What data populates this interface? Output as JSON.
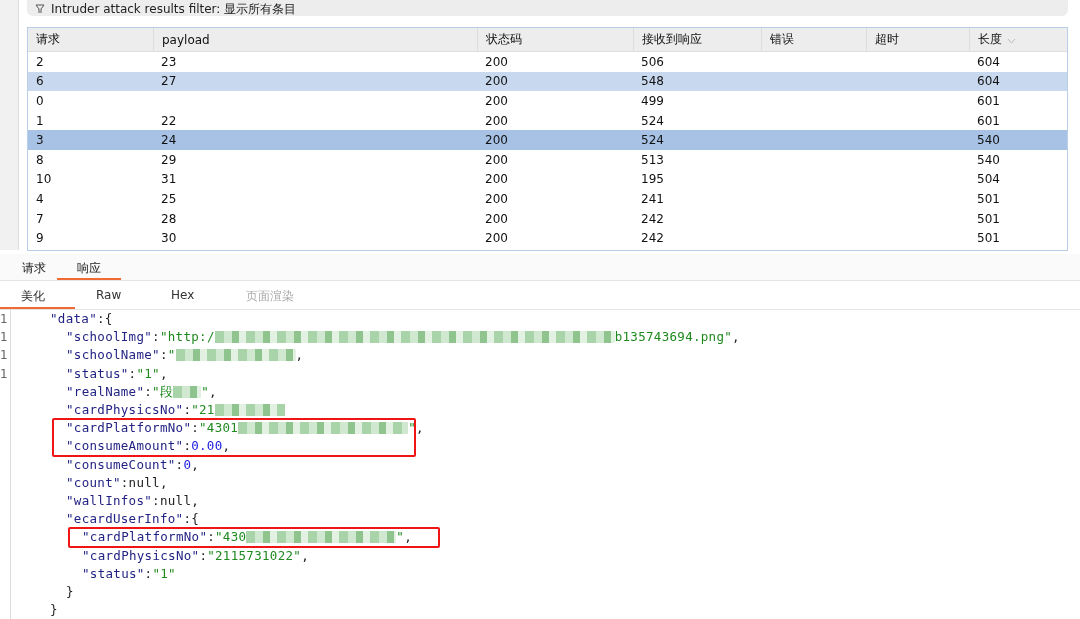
{
  "filter_bar": {
    "label": "Intruder attack results filter: 显示所有条目"
  },
  "table": {
    "columns": [
      {
        "label": "请求",
        "sorted": false
      },
      {
        "label": "payload",
        "sorted": false
      },
      {
        "label": "状态码",
        "sorted": false
      },
      {
        "label": "接收到响应",
        "sorted": false
      },
      {
        "label": "错误",
        "sorted": false
      },
      {
        "label": "超时",
        "sorted": false
      },
      {
        "label": "长度",
        "sorted": true
      }
    ],
    "rows": [
      {
        "cells": [
          "2",
          "23",
          "200",
          "506",
          "",
          "",
          "604"
        ],
        "selected": false,
        "focused": false
      },
      {
        "cells": [
          "6",
          "27",
          "200",
          "548",
          "",
          "",
          "604"
        ],
        "selected": true,
        "focused": false
      },
      {
        "cells": [
          "0",
          "",
          "200",
          "499",
          "",
          "",
          "601"
        ],
        "selected": false,
        "focused": false
      },
      {
        "cells": [
          "1",
          "22",
          "200",
          "524",
          "",
          "",
          "601"
        ],
        "selected": false,
        "focused": false
      },
      {
        "cells": [
          "3",
          "24",
          "200",
          "524",
          "",
          "",
          "540"
        ],
        "selected": true,
        "focused": true
      },
      {
        "cells": [
          "8",
          "29",
          "200",
          "513",
          "",
          "",
          "540"
        ],
        "selected": false,
        "focused": false
      },
      {
        "cells": [
          "10",
          "31",
          "200",
          "195",
          "",
          "",
          "504"
        ],
        "selected": false,
        "focused": false
      },
      {
        "cells": [
          "4",
          "25",
          "200",
          "241",
          "",
          "",
          "501"
        ],
        "selected": false,
        "focused": false
      },
      {
        "cells": [
          "7",
          "28",
          "200",
          "242",
          "",
          "",
          "501"
        ],
        "selected": false,
        "focused": false
      },
      {
        "cells": [
          "9",
          "30",
          "200",
          "242",
          "",
          "",
          "501"
        ],
        "selected": false,
        "focused": false
      }
    ]
  },
  "tabs": [
    {
      "label": "请求",
      "selected": false
    },
    {
      "label": "响应",
      "selected": true
    }
  ],
  "view_tabs": [
    {
      "label": "美化",
      "selected": true,
      "disabled": false
    },
    {
      "label": "Raw",
      "selected": false,
      "disabled": false
    },
    {
      "label": "Hex",
      "selected": false,
      "disabled": false
    },
    {
      "label": "页面渲染",
      "selected": false,
      "disabled": true
    }
  ],
  "gutter": [
    "1",
    "1",
    "1",
    "1"
  ],
  "code": [
    {
      "highlighted": false,
      "tokens": [
        {
          "kind": "key",
          "text": "\"data\""
        },
        {
          "kind": "punct",
          "text": ":{"
        }
      ],
      "children": [
        {
          "highlighted": false,
          "tokens": [
            {
              "kind": "key",
              "text": "\"schoolImg\""
            },
            {
              "kind": "punct",
              "text": ":"
            },
            {
              "kind": "str",
              "text": "\"http:/"
            },
            {
              "kind": "blur"
            },
            {
              "kind": "str",
              "text": "b135743694.png\""
            },
            {
              "kind": "punct",
              "text": ","
            }
          ]
        },
        {
          "highlighted": false,
          "tokens": [
            {
              "kind": "key",
              "text": "\"schoolName\""
            },
            {
              "kind": "punct",
              "text": ":"
            },
            {
              "kind": "str",
              "text": "\""
            },
            {
              "kind": "blur"
            },
            {
              "kind": "punct",
              "text": ","
            }
          ]
        },
        {
          "highlighted": false,
          "tokens": [
            {
              "kind": "key",
              "text": "\"status\""
            },
            {
              "kind": "punct",
              "text": ":"
            },
            {
              "kind": "str",
              "text": "\"1\""
            },
            {
              "kind": "punct",
              "text": ","
            }
          ]
        },
        {
          "highlighted": false,
          "tokens": [
            {
              "kind": "key",
              "text": "\"realName\""
            },
            {
              "kind": "punct",
              "text": ":"
            },
            {
              "kind": "str",
              "text": "\"段"
            },
            {
              "kind": "blur"
            },
            {
              "kind": "str",
              "text": "\""
            },
            {
              "kind": "punct",
              "text": ","
            }
          ]
        },
        {
          "highlighted": false,
          "tokens": [
            {
              "kind": "key",
              "text": "\"cardPhysicsNo\""
            },
            {
              "kind": "punct",
              "text": ":"
            },
            {
              "kind": "str",
              "text": "\"21"
            },
            {
              "kind": "blur"
            }
          ]
        },
        {
          "highlighted": true,
          "tokens": [
            {
              "kind": "key",
              "text": "\"cardPlatformNo\""
            },
            {
              "kind": "punct",
              "text": ":"
            },
            {
              "kind": "str",
              "text": "\"4301"
            },
            {
              "kind": "blur"
            },
            {
              "kind": "str",
              "text": "\""
            },
            {
              "kind": "punct",
              "text": ","
            }
          ]
        },
        {
          "highlighted": true,
          "tokens": [
            {
              "kind": "key",
              "text": "\"consumeAmount\""
            },
            {
              "kind": "punct",
              "text": ":"
            },
            {
              "kind": "num",
              "text": "0.00"
            },
            {
              "kind": "punct",
              "text": ","
            }
          ]
        },
        {
          "highlighted": false,
          "tokens": [
            {
              "kind": "key",
              "text": "\"consumeCount\""
            },
            {
              "kind": "punct",
              "text": ":"
            },
            {
              "kind": "num",
              "text": "0"
            },
            {
              "kind": "punct",
              "text": ","
            }
          ]
        },
        {
          "highlighted": false,
          "tokens": [
            {
              "kind": "key",
              "text": "\"count\""
            },
            {
              "kind": "punct",
              "text": ":null,"
            }
          ]
        },
        {
          "highlighted": false,
          "tokens": [
            {
              "kind": "key",
              "text": "\"wallInfos\""
            },
            {
              "kind": "punct",
              "text": ":null,"
            }
          ]
        },
        {
          "highlighted": false,
          "tokens": [
            {
              "kind": "key",
              "text": "\"ecardUserInfo\""
            },
            {
              "kind": "punct",
              "text": ":{"
            }
          ],
          "children": [
            {
              "highlighted": true,
              "tokens": [
                {
                  "kind": "key",
                  "text": "\"cardPlatformNo\""
                },
                {
                  "kind": "punct",
                  "text": ":"
                },
                {
                  "kind": "str",
                  "text": "\"430"
                },
                {
                  "kind": "blur"
                },
                {
                  "kind": "str",
                  "text": "\""
                },
                {
                  "kind": "punct",
                  "text": ","
                }
              ]
            },
            {
              "highlighted": false,
              "tokens": [
                {
                  "kind": "key",
                  "text": "\"cardPhysicsNo\""
                },
                {
                  "kind": "punct",
                  "text": ":"
                },
                {
                  "kind": "str",
                  "text": "\"2115731022\""
                },
                {
                  "kind": "punct",
                  "text": ","
                }
              ]
            },
            {
              "highlighted": false,
              "tokens": [
                {
                  "kind": "key",
                  "text": "\"status\""
                },
                {
                  "kind": "punct",
                  "text": ":"
                },
                {
                  "kind": "str",
                  "text": "\"1\""
                }
              ]
            }
          ]
        },
        {
          "highlighted": false,
          "tokens": [
            {
              "kind": "punct",
              "text": "}"
            }
          ]
        }
      ]
    },
    {
      "highlighted": false,
      "tokens": [
        {
          "kind": "punct",
          "text": "}"
        }
      ]
    }
  ]
}
